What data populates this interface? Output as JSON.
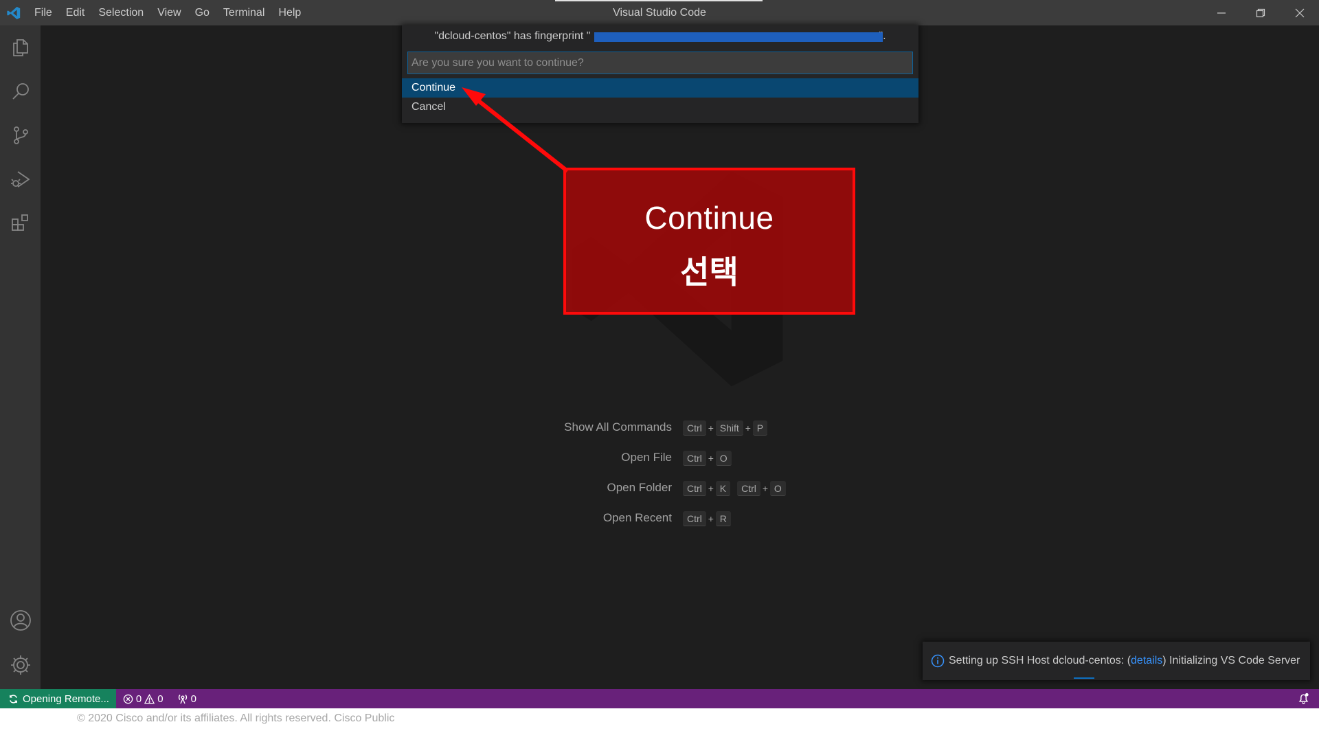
{
  "titlebar": {
    "menu": [
      "File",
      "Edit",
      "Selection",
      "View",
      "Go",
      "Terminal",
      "Help"
    ],
    "window_title": "Visual Studio Code",
    "controls": [
      "minimize-icon",
      "restore-icon",
      "close-icon"
    ]
  },
  "activitybar": {
    "top_icons": [
      "explorer-icon",
      "search-icon",
      "source-control-icon",
      "run-debug-icon",
      "extensions-icon"
    ],
    "bottom_icons": [
      "accounts-icon",
      "settings-gear-icon"
    ]
  },
  "quick_input": {
    "title_prefix": "\"dcloud-centos\" has fingerprint \"",
    "title_suffix": "\".",
    "placeholder": "Are you sure you want to continue?",
    "options": [
      "Continue",
      "Cancel"
    ],
    "selected_index": 0
  },
  "callout": {
    "line1": "Continue",
    "line2": "선택",
    "border_color": "#ff0a0a"
  },
  "shortcuts": [
    {
      "label": "Show All Commands",
      "keys": [
        [
          "Ctrl",
          "Shift",
          "P"
        ]
      ]
    },
    {
      "label": "Open File",
      "keys": [
        [
          "Ctrl",
          "O"
        ]
      ]
    },
    {
      "label": "Open Folder",
      "keys": [
        [
          "Ctrl",
          "K"
        ],
        [
          "Ctrl",
          "O"
        ]
      ]
    },
    {
      "label": "Open Recent",
      "keys": [
        [
          "Ctrl",
          "R"
        ]
      ]
    }
  ],
  "notification": {
    "text_before": "Setting up SSH Host dcloud-centos: (",
    "link": "details",
    "text_after": ") Initializing VS Code Server"
  },
  "statusbar": {
    "remote_label": "Opening Remote...",
    "errors": "0",
    "warnings": "0",
    "ports": "0",
    "remote_color": "#16825d",
    "bar_color": "#68217a"
  },
  "footer": {
    "copyright": "© 2020 Cisco and/or its affiliates. All rights reserved. Cisco Public"
  }
}
